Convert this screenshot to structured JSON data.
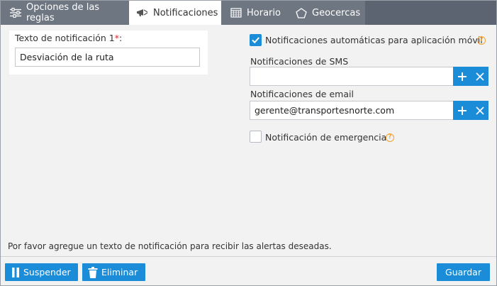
{
  "tabs": [
    {
      "label": "Opciones de las reglas",
      "icon": "sliders-icon"
    },
    {
      "label": "Notificaciones",
      "icon": "megaphone-icon",
      "active": true
    },
    {
      "label": "Horario",
      "icon": "calendar-icon"
    },
    {
      "label": "Geocercas",
      "icon": "pentagon-icon"
    }
  ],
  "left": {
    "notification_text_label": "Texto de notificación 1",
    "required_mark": "*",
    "label_suffix": ":",
    "notification_text_value": "Desviación de la ruta"
  },
  "right": {
    "auto_notifications_label": "Notificaciones automáticas para aplicación móvil",
    "auto_notifications_checked": true,
    "sms_label": "Notificaciones de SMS",
    "sms_value": "",
    "email_label": "Notificaciones de email",
    "email_value": "gerente@transportesnorte.com",
    "emergency_label": "Notificación de emergencia",
    "emergency_checked": false,
    "help_glyph": "?"
  },
  "hint": "Por favor agregue un texto de notificación para recibir las alertas deseadas.",
  "footer": {
    "suspend_label": "Suspender",
    "delete_label": "Eliminar",
    "save_label": "Guardar"
  },
  "colors": {
    "accent": "#1a8cd8",
    "tabbar": "#5b6470",
    "help": "#f0a330",
    "required": "#d9262c"
  }
}
